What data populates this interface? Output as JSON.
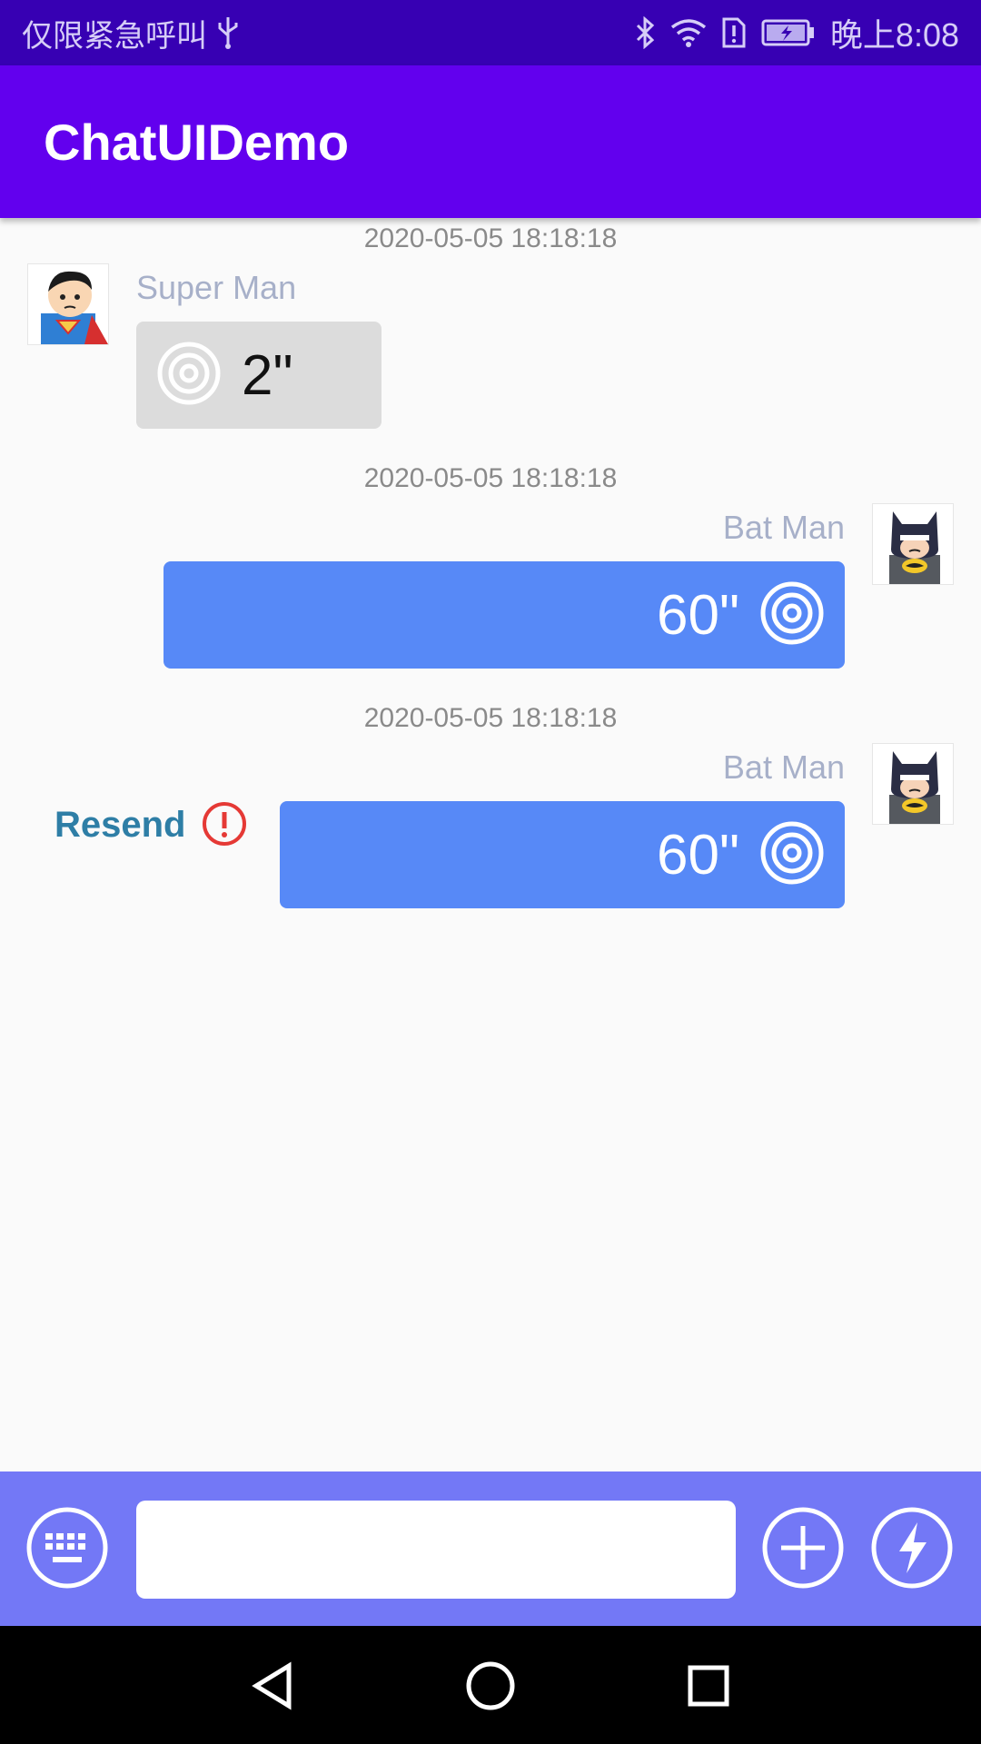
{
  "status_bar": {
    "carrier_text": "仅限紧急呼叫",
    "time": "晚上8:08",
    "icons": [
      "usb-icon",
      "bluetooth-icon",
      "wifi-icon",
      "sim-alert-icon",
      "battery-charging-icon"
    ]
  },
  "app_bar": {
    "title": "ChatUIDemo"
  },
  "messages": [
    {
      "timestamp": "2020-05-05 18:18:18",
      "sender": "Super Man",
      "side": "left",
      "duration": "2\"",
      "avatar": "superman-avatar"
    },
    {
      "timestamp": "2020-05-05 18:18:18",
      "sender": "Bat Man",
      "side": "right",
      "duration": "60\"",
      "avatar": "batman-avatar"
    },
    {
      "timestamp": "2020-05-05 18:18:18",
      "sender": "Bat Man",
      "side": "right",
      "duration": "60\"",
      "avatar": "batman-avatar",
      "failed": true,
      "resend_label": "Resend"
    }
  ],
  "input_bar": {
    "input_value": "",
    "icons": [
      "keyboard-icon",
      "add-icon",
      "lightning-icon"
    ]
  },
  "colors": {
    "status_bar": "#3700b3",
    "app_bar": "#6200ee",
    "bubble_right": "#5789f7",
    "bubble_left": "#dcdcdc",
    "input_bar": "#7378f6",
    "resend": "#2e7ea6",
    "error": "#e53935"
  }
}
